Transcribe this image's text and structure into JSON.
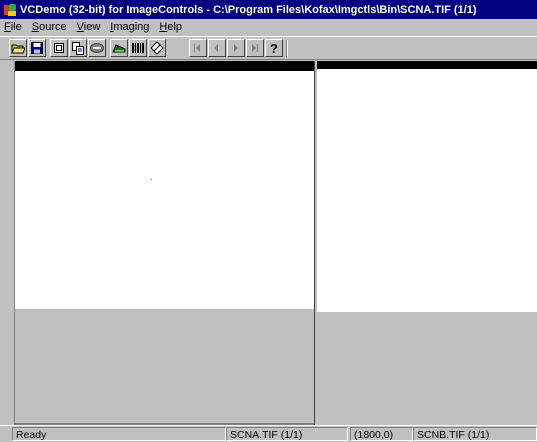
{
  "window": {
    "title": "VCDemo (32-bit) for ImageControls - C:\\Program Files\\Kofax\\Imgctls\\Bin\\SCNA.TIF  (1/1)"
  },
  "menu": [
    {
      "label_u": "F",
      "label_rest": "ile"
    },
    {
      "label_u": "S",
      "label_rest": "ource"
    },
    {
      "label_u": "V",
      "label_rest": "iew"
    },
    {
      "label_u": "I",
      "label_rest": "maging"
    },
    {
      "label_u": "H",
      "label_rest": "elp"
    }
  ],
  "toolbar": {
    "icons": [
      "open-folder-icon",
      "save-disk-icon",
      "properties-icon",
      "copy-icon",
      "ocr-icon",
      "scanner-icon",
      "barcode-icon",
      "eraser-icon",
      "first-page-icon",
      "previous-page-icon",
      "next-page-icon",
      "last-page-icon",
      "help-icon"
    ],
    "disabled": [
      "first-page-icon",
      "previous-page-icon",
      "next-page-icon",
      "last-page-icon"
    ]
  },
  "statusbar": {
    "ready": "Ready",
    "left_file": "SCNA.TIF  (1/1)",
    "coords": "(1800,0)",
    "right_file": "SCNB.TIF  (1/1)"
  }
}
